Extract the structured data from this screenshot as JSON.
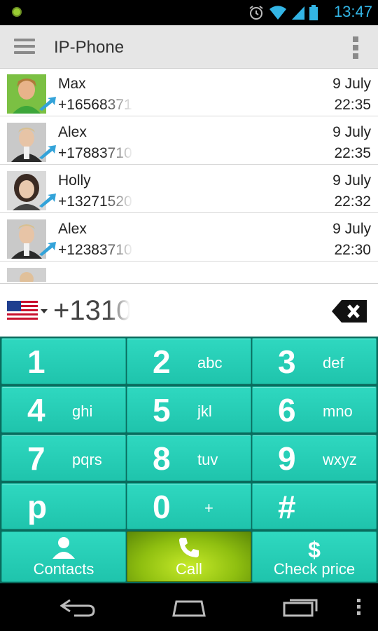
{
  "status_bar": {
    "time": "13:47"
  },
  "action_bar": {
    "title": "IP-Phone"
  },
  "call_log": [
    {
      "name": "Max",
      "number": "+16568371",
      "date": "9 July",
      "time": "22:35"
    },
    {
      "name": "Alex",
      "number": "+17883710",
      "date": "9 July",
      "time": "22:35"
    },
    {
      "name": "Holly",
      "number": "+13271520",
      "date": "9 July",
      "time": "22:32"
    },
    {
      "name": "Alex",
      "number": "+12383710",
      "date": "9 July",
      "time": "22:30"
    }
  ],
  "dial": {
    "number": "+1310"
  },
  "keypad": {
    "keys": [
      {
        "digit": "1",
        "letters": ""
      },
      {
        "digit": "2",
        "letters": "abc"
      },
      {
        "digit": "3",
        "letters": "def"
      },
      {
        "digit": "4",
        "letters": "ghi"
      },
      {
        "digit": "5",
        "letters": "jkl"
      },
      {
        "digit": "6",
        "letters": "mno"
      },
      {
        "digit": "7",
        "letters": "pqrs"
      },
      {
        "digit": "8",
        "letters": "tuv"
      },
      {
        "digit": "9",
        "letters": "wxyz"
      },
      {
        "digit": "p",
        "letters": ""
      },
      {
        "digit": "0",
        "letters": "+"
      },
      {
        "digit": "#",
        "letters": ""
      }
    ],
    "contacts_label": "Contacts",
    "call_label": "Call",
    "check_price_label": "Check price"
  },
  "colors": {
    "key": "#1fc4ac",
    "call": "#8fbf10",
    "status_accent": "#33b5e5"
  }
}
